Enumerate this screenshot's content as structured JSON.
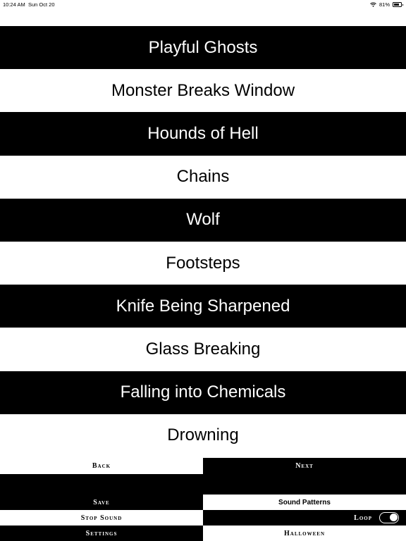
{
  "status_bar": {
    "time": "10:24 AM",
    "date": "Sun Oct 20",
    "battery": "81%"
  },
  "sounds": [
    "Playful Ghosts",
    "Monster Breaks Window",
    "Hounds of Hell",
    "Chains",
    "Wolf",
    "Footsteps",
    "Knife Being Sharpened",
    "Glass Breaking",
    "Falling into Chemicals",
    "Drowning"
  ],
  "controls": {
    "back": "Back",
    "next": "Next",
    "save": "Save",
    "sound_patterns": "Sound Patterns",
    "stop_sound": "Stop Sound",
    "loop": "Loop",
    "loop_on": false,
    "settings": "Settings",
    "category": "Halloween"
  }
}
